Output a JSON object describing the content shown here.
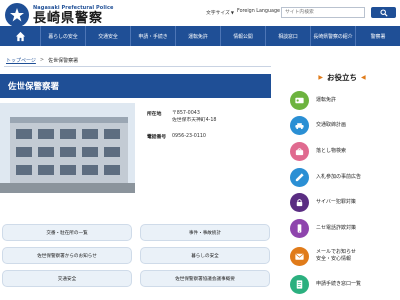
{
  "header": {
    "logo_sub": "Nagasaki Prefectural Police",
    "logo_title": "長崎県警察",
    "font_size_label": "文字サイズ",
    "language_label": "Foreign Language",
    "search_placeholder": "サイト内検索",
    "brand_color": "#1f4f96"
  },
  "nav": {
    "home_icon": "home-icon",
    "items": [
      "暮らしの安全",
      "交通安全",
      "申請・手続き",
      "運転免許",
      "情報公開",
      "相談窓口",
      "長崎県警察の紹介",
      "警察署"
    ]
  },
  "breadcrumb": {
    "home": "トップページ",
    "separator": ">",
    "current": "佐世保警察署"
  },
  "page": {
    "title": "佐世保警察署"
  },
  "info": {
    "address_label": "所在地",
    "postal": "〒857-0043",
    "address": "佐世保市天神町4-18",
    "phone_label": "電話番号",
    "phone": "0956-23-0110"
  },
  "links": [
    "交番・駐在所の一覧",
    "事件・事故統計",
    "佐世保警察署からのお知らせ",
    "暮らしの安全",
    "交通安全",
    "佐世保警察署協議会議事概要"
  ],
  "sidebar": {
    "title": "お役立ち",
    "items": [
      {
        "label": "運転免許",
        "icon": "license-card-icon",
        "color": "#6db33f"
      },
      {
        "label": "交通取締計画",
        "icon": "police-car-icon",
        "color": "#2a8fd4"
      },
      {
        "label": "落とし物検索",
        "icon": "purse-icon",
        "color": "#e06a8f"
      },
      {
        "label": "入札参加の事前広告",
        "icon": "pen-icon",
        "color": "#2a8fd4"
      },
      {
        "label": "サイバー犯罪対策",
        "icon": "lock-icon",
        "color": "#5a2d82"
      },
      {
        "label": "ニセ電話詐欺対策",
        "icon": "phone-icon",
        "color": "#8e44ad"
      },
      {
        "label": "メールでお知らせ",
        "label2": "安全・安心情報",
        "icon": "mail-icon",
        "color": "#e07b1a"
      },
      {
        "label": "申請手続き窓口一覧",
        "icon": "document-icon",
        "color": "#2bb07f"
      }
    ]
  }
}
